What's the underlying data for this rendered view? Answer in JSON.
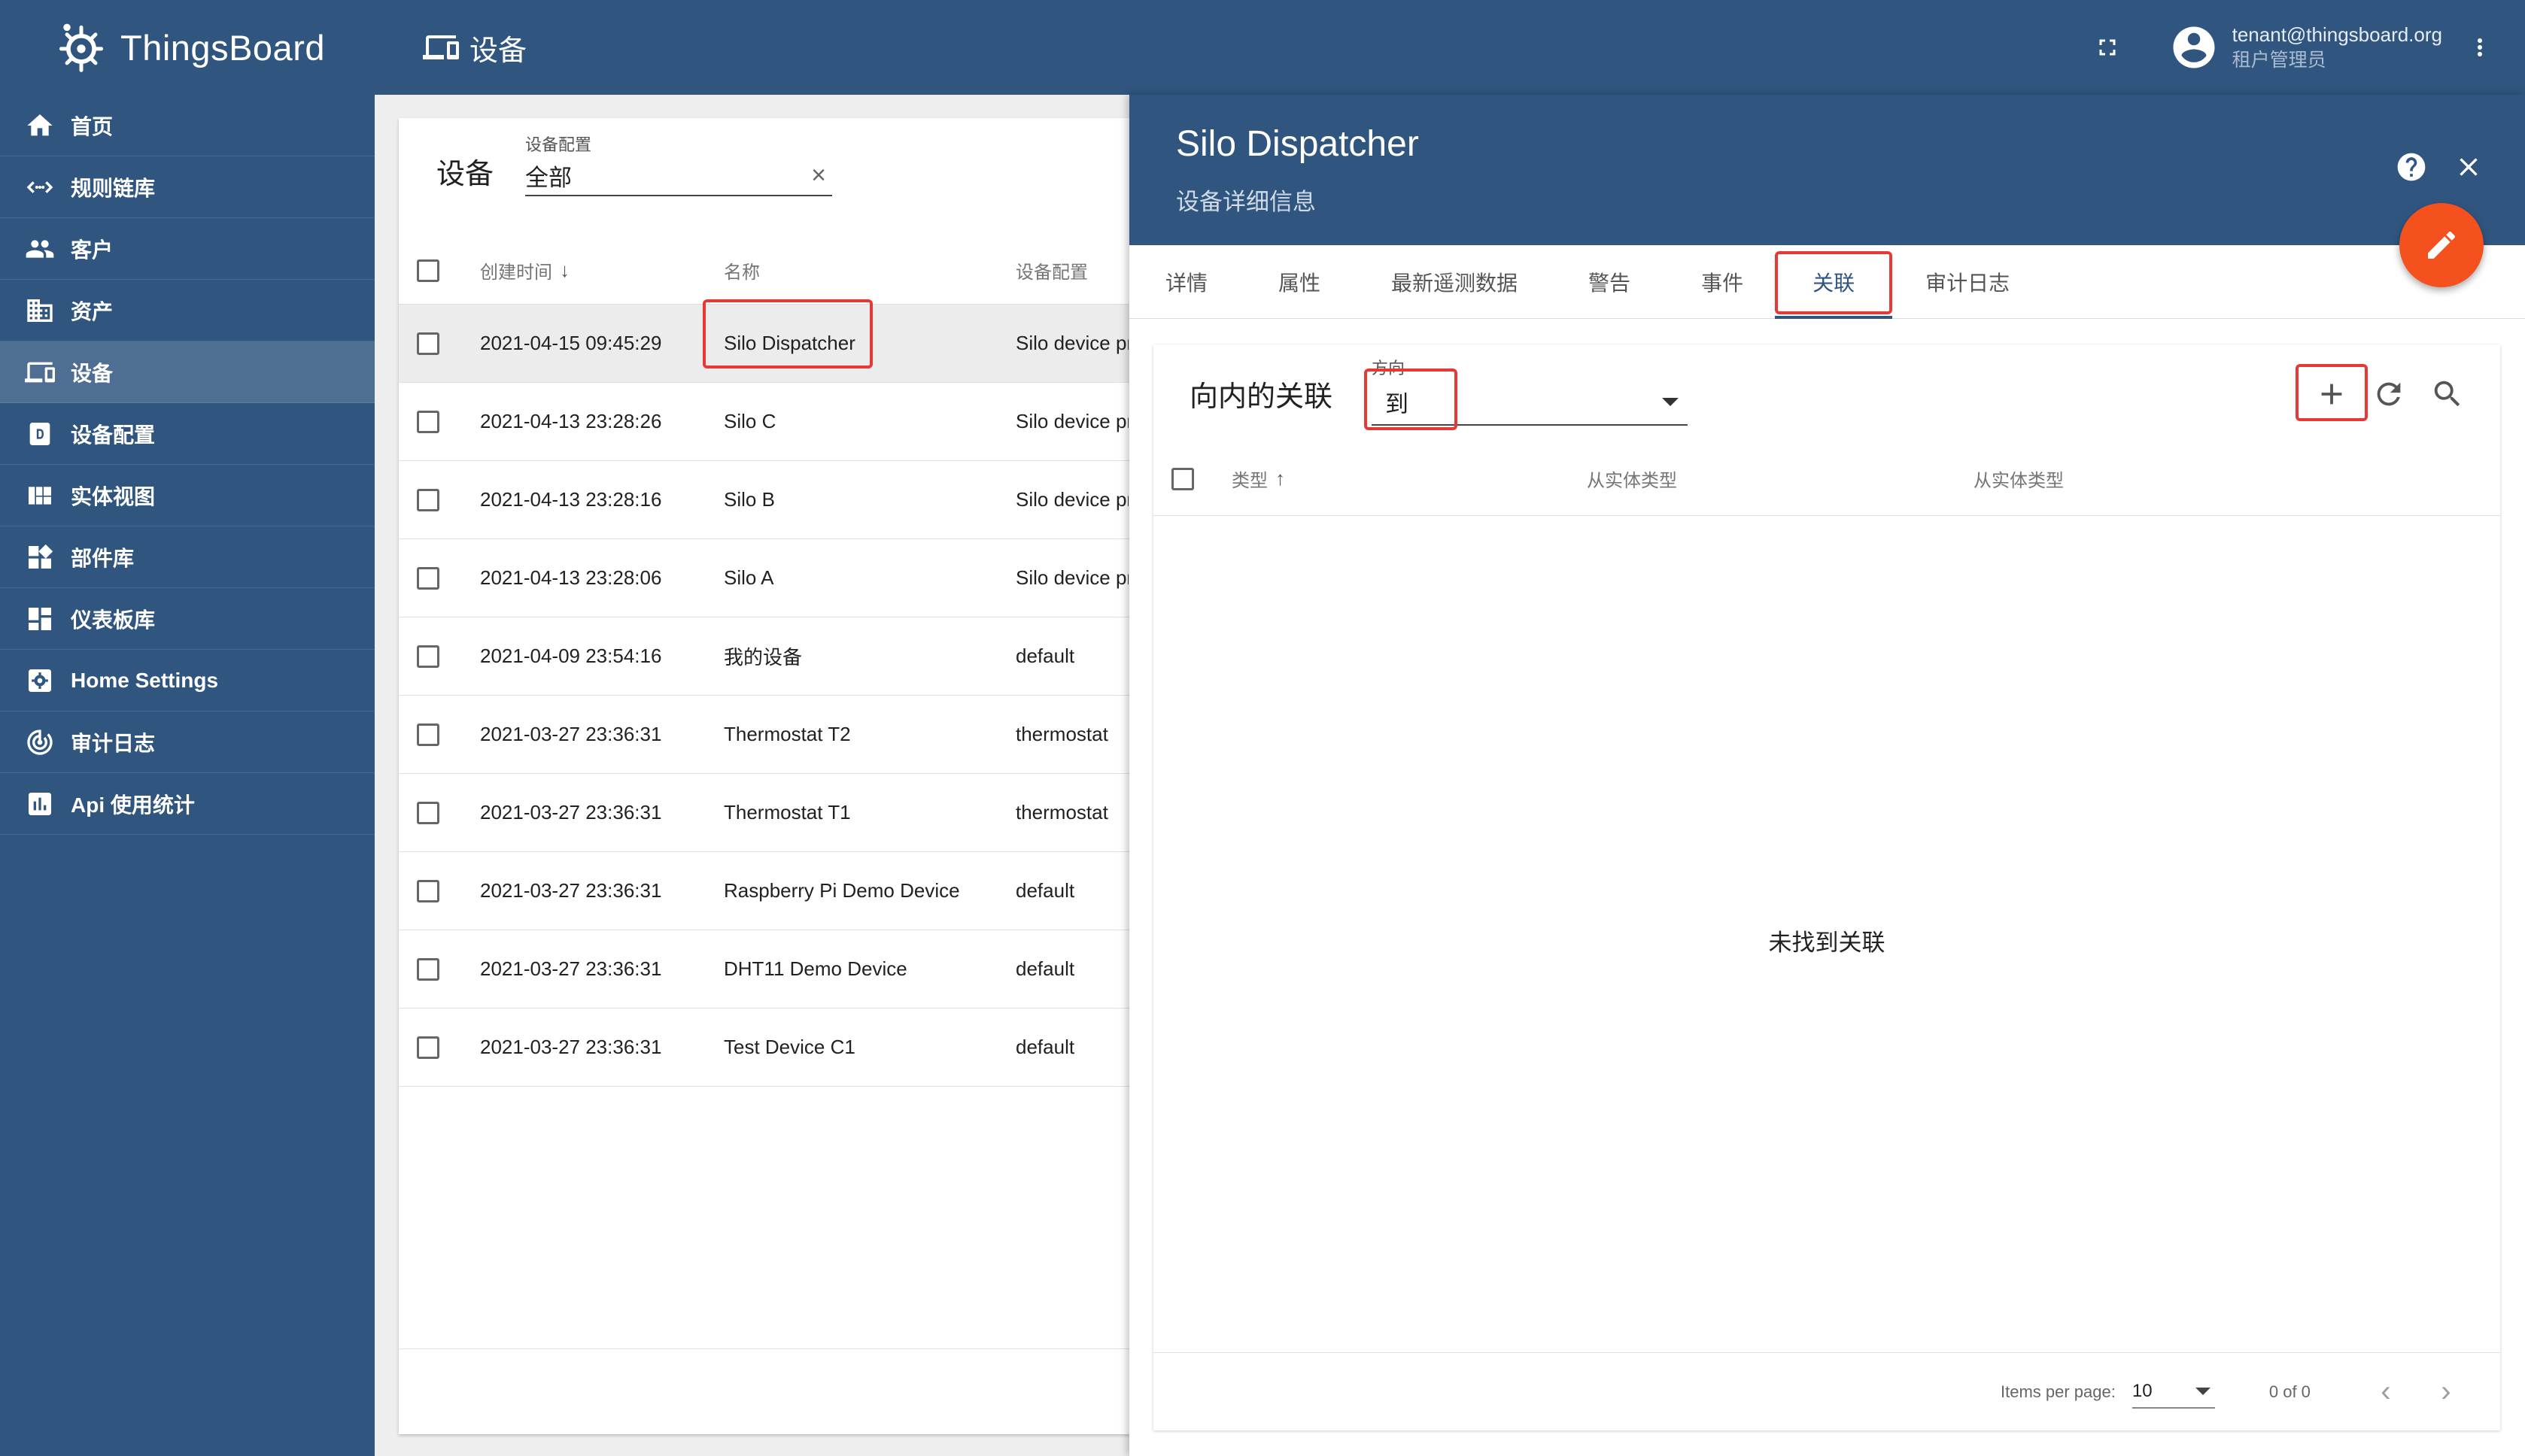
{
  "app": {
    "brand": "ThingsBoard",
    "page_title": "设备"
  },
  "user": {
    "email": "tenant@thingsboard.org",
    "role": "租户管理员"
  },
  "sidebar": {
    "items": [
      {
        "label": "首页",
        "icon": "home-icon"
      },
      {
        "label": "规则链库",
        "icon": "code-arrows-icon"
      },
      {
        "label": "客户",
        "icon": "people-icon"
      },
      {
        "label": "资产",
        "icon": "domain-icon"
      },
      {
        "label": "设备",
        "icon": "devices-icon",
        "active": true
      },
      {
        "label": "设备配置",
        "icon": "device-profile-icon"
      },
      {
        "label": "实体视图",
        "icon": "view-quilt-icon"
      },
      {
        "label": "部件库",
        "icon": "widgets-icon"
      },
      {
        "label": "仪表板库",
        "icon": "dashboard-icon"
      },
      {
        "label": "Home Settings",
        "icon": "settings-icon"
      },
      {
        "label": "审计日志",
        "icon": "track-changes-icon"
      },
      {
        "label": "Api 使用统计",
        "icon": "insert-chart-icon"
      }
    ]
  },
  "device_list": {
    "title": "设备",
    "filter": {
      "label": "设备配置",
      "value": "全部"
    },
    "columns": {
      "created": "创建时间",
      "name": "名称",
      "profile": "设备配置"
    },
    "rows": [
      {
        "created": "2021-04-15 09:45:29",
        "name": "Silo Dispatcher",
        "profile": "Silo device profile"
      },
      {
        "created": "2021-04-13 23:28:26",
        "name": "Silo C",
        "profile": "Silo device profile"
      },
      {
        "created": "2021-04-13 23:28:16",
        "name": "Silo B",
        "profile": "Silo device profile"
      },
      {
        "created": "2021-04-13 23:28:06",
        "name": "Silo A",
        "profile": "Silo device profile"
      },
      {
        "created": "2021-04-09 23:54:16",
        "name": "我的设备",
        "profile": "default"
      },
      {
        "created": "2021-03-27 23:36:31",
        "name": "Thermostat T2",
        "profile": "thermostat"
      },
      {
        "created": "2021-03-27 23:36:31",
        "name": "Thermostat T1",
        "profile": "thermostat"
      },
      {
        "created": "2021-03-27 23:36:31",
        "name": "Raspberry Pi Demo Device",
        "profile": "default"
      },
      {
        "created": "2021-03-27 23:36:31",
        "name": "DHT11 Demo Device",
        "profile": "default"
      },
      {
        "created": "2021-03-27 23:36:31",
        "name": "Test Device C1",
        "profile": "default"
      }
    ]
  },
  "details": {
    "title": "Silo Dispatcher",
    "subtitle": "设备详细信息",
    "tabs": [
      {
        "label": "详情"
      },
      {
        "label": "属性"
      },
      {
        "label": "最新遥测数据"
      },
      {
        "label": "警告"
      },
      {
        "label": "事件"
      },
      {
        "label": "关联",
        "active": true
      },
      {
        "label": "审计日志"
      }
    ],
    "relations": {
      "title": "向内的关联",
      "direction_label": "方向",
      "direction_value": "到",
      "columns": {
        "type": "类型",
        "from_type": "从实体类型",
        "from_name": "从实体类型"
      },
      "empty_message": "未找到关联",
      "paginator": {
        "items_per_page_label": "Items per page:",
        "page_size": "10",
        "range": "0 of 0"
      }
    }
  },
  "colors": {
    "primary": "#305680",
    "accent": "#f4511e",
    "highlight": "#e53935"
  }
}
